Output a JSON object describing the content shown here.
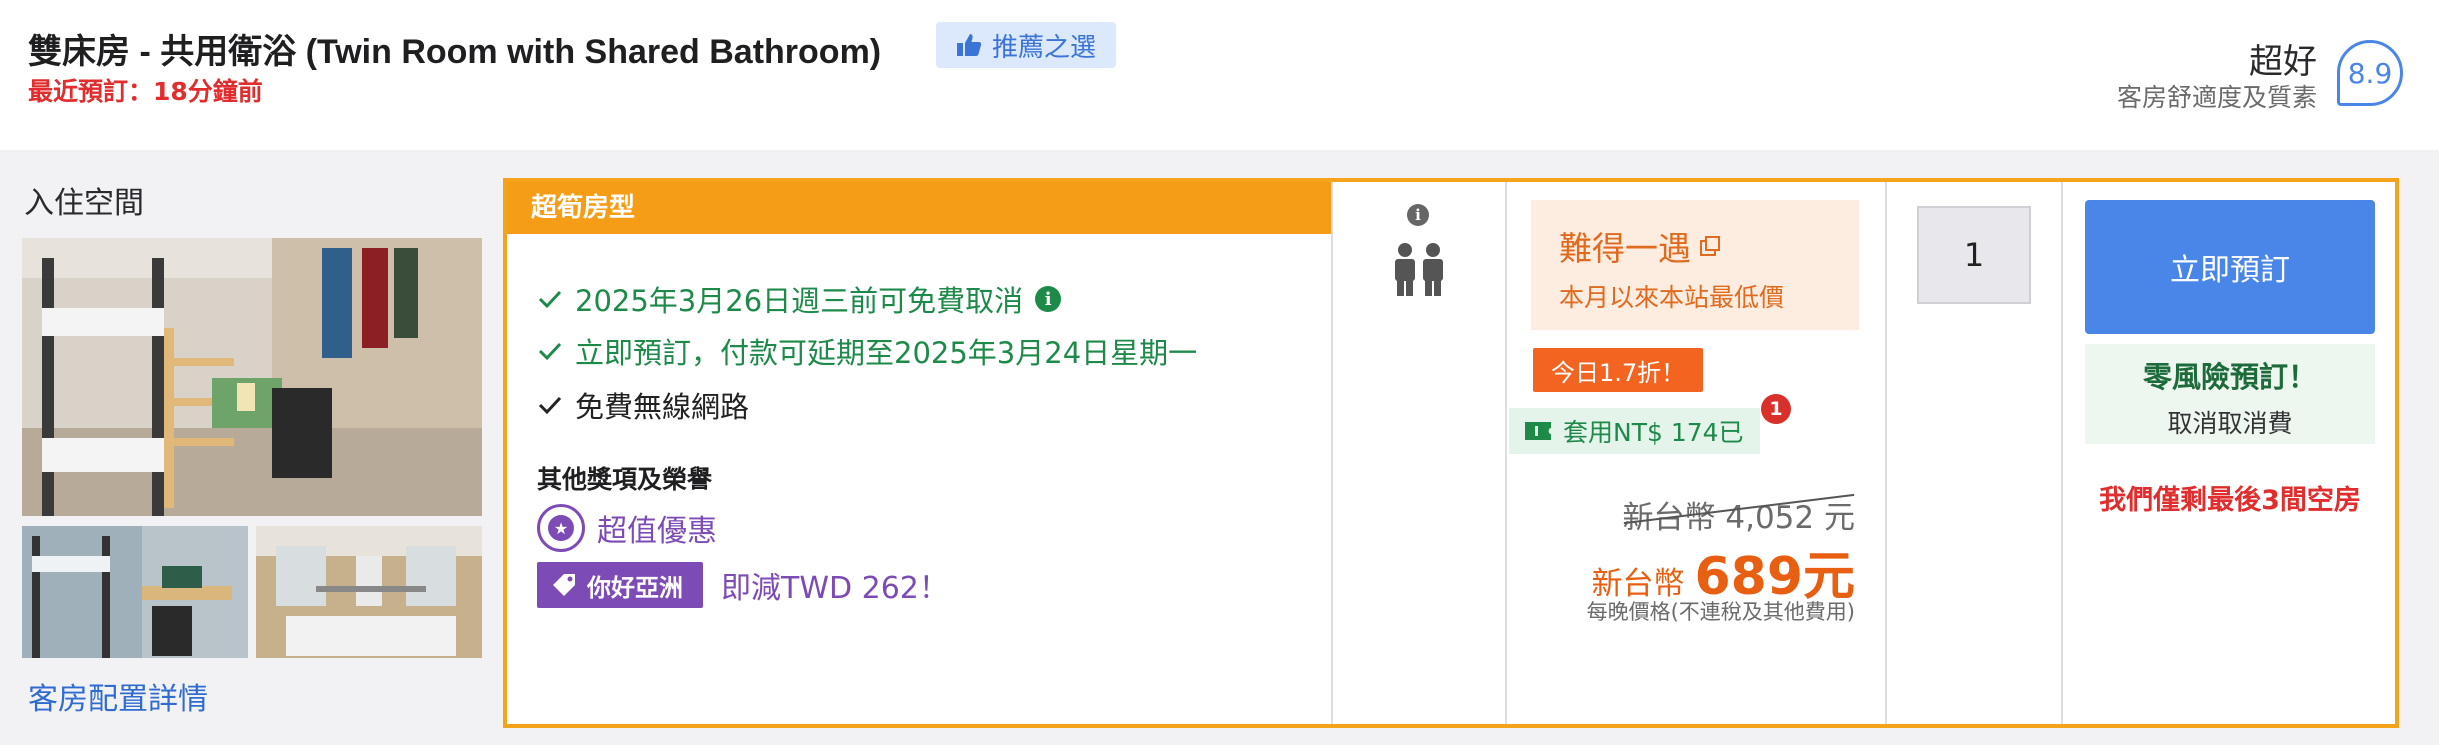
{
  "header": {
    "room_title": "雙床房 - 共用衛浴 (Twin Room with Shared Bathroom)",
    "recommended_badge": "推薦之選",
    "recent_booking": "最近預訂：18分鐘前",
    "score_word": "超好",
    "score_sub": "客房舒適度及質素",
    "score_value": "8.9"
  },
  "left": {
    "space_title": "入住空間",
    "config_link": "客房配置詳情"
  },
  "offer": {
    "tag": "超筍房型",
    "perks": [
      {
        "text": "2025年3月26日週三前可免費取消",
        "style": "green",
        "info": true
      },
      {
        "text": "立即預訂，付款可延期至2025年3月24日星期一",
        "style": "green",
        "info": false
      },
      {
        "text": "免費無線網路",
        "style": "dark",
        "info": false
      }
    ],
    "other_title": "其他獎項及榮譽",
    "value_label": "超值優惠",
    "promo_tag": "你好亞洲",
    "promo_text": "即減TWD 262！"
  },
  "price": {
    "deal_title": "難得一遇",
    "deal_sub": "本月以來本站最低價",
    "today_badge": "今日1.7折！",
    "coupon_text": "套用NT$ 174已",
    "coupon_count": "1",
    "original_price": "新台幣 4,052 元",
    "new_price_currency": "新台幣",
    "new_price_value": "689元",
    "per_night": "每晚價格(不連稅及其他費用)"
  },
  "quantity": {
    "value": "1"
  },
  "booking": {
    "book_button": "立即預訂",
    "no_risk_title": "零風險預訂！",
    "no_risk_sub": "取消取消費",
    "rooms_left": "我們僅剩最後3間空房"
  },
  "colors": {
    "accent_orange": "#f5a31a",
    "brand_blue": "#4a86e8",
    "green": "#1e8a4a",
    "purple": "#7d4bb6",
    "red": "#e12d2d"
  }
}
